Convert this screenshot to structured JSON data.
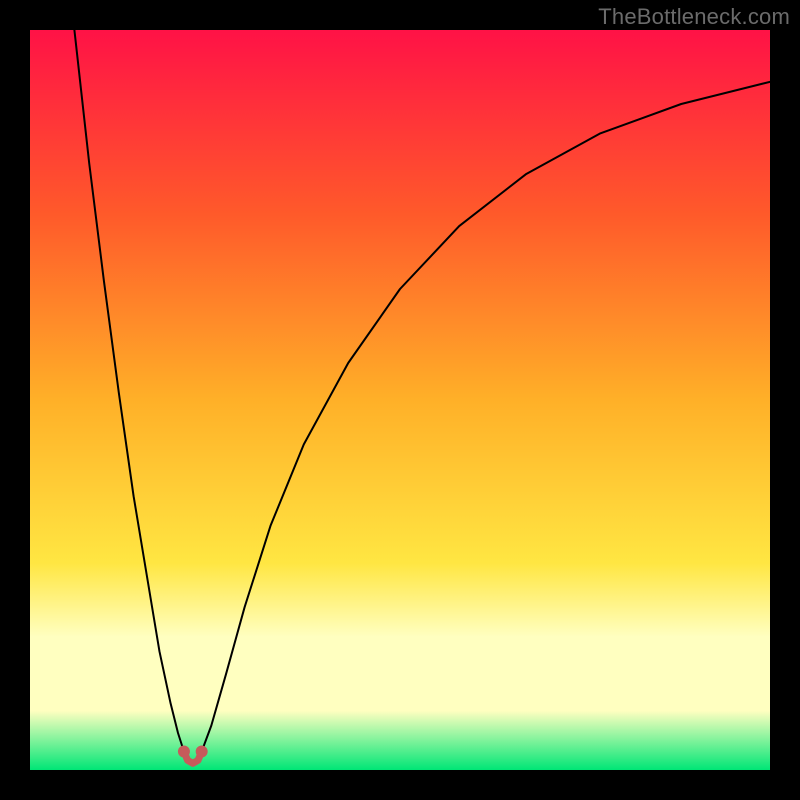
{
  "watermark": "TheBottleneck.com",
  "colors": {
    "frame": "#000000",
    "watermark_text": "#6b6b6b",
    "gradient_top": "#ff1246",
    "gradient_upper_mid": "#ff5a2a",
    "gradient_mid": "#ffb028",
    "gradient_lower_mid": "#ffe642",
    "gradient_pale": "#ffffc0",
    "gradient_bottom": "#00e676",
    "curve": "#000000",
    "marker_fill": "#c65b5b",
    "marker_stroke": "#c65b5b"
  },
  "chart_data": {
    "type": "line",
    "title": "",
    "xlabel": "",
    "ylabel": "",
    "xlim": [
      0,
      100
    ],
    "ylim": [
      0,
      100
    ],
    "legend": false,
    "grid": false,
    "gradient_stops": [
      {
        "offset": 0.0,
        "color_key": "gradient_top"
      },
      {
        "offset": 0.25,
        "color_key": "gradient_upper_mid"
      },
      {
        "offset": 0.5,
        "color_key": "gradient_mid"
      },
      {
        "offset": 0.72,
        "color_key": "gradient_lower_mid"
      },
      {
        "offset": 0.82,
        "color_key": "gradient_pale"
      },
      {
        "offset": 0.92,
        "color_key": "gradient_pale"
      },
      {
        "offset": 1.0,
        "color_key": "gradient_bottom"
      }
    ],
    "series": [
      {
        "name": "left-arm",
        "stroke_key": "curve",
        "stroke_width": 2,
        "points": [
          {
            "x": 6.0,
            "y": 100.0
          },
          {
            "x": 8.0,
            "y": 82.0
          },
          {
            "x": 10.0,
            "y": 66.0
          },
          {
            "x": 12.0,
            "y": 51.0
          },
          {
            "x": 14.0,
            "y": 37.0
          },
          {
            "x": 16.0,
            "y": 25.0
          },
          {
            "x": 17.5,
            "y": 16.0
          },
          {
            "x": 19.0,
            "y": 9.0
          },
          {
            "x": 20.0,
            "y": 5.0
          },
          {
            "x": 20.8,
            "y": 2.5
          }
        ]
      },
      {
        "name": "right-arm",
        "stroke_key": "curve",
        "stroke_width": 2,
        "points": [
          {
            "x": 23.2,
            "y": 2.5
          },
          {
            "x": 24.5,
            "y": 6.0
          },
          {
            "x": 26.5,
            "y": 13.0
          },
          {
            "x": 29.0,
            "y": 22.0
          },
          {
            "x": 32.5,
            "y": 33.0
          },
          {
            "x": 37.0,
            "y": 44.0
          },
          {
            "x": 43.0,
            "y": 55.0
          },
          {
            "x": 50.0,
            "y": 65.0
          },
          {
            "x": 58.0,
            "y": 73.5
          },
          {
            "x": 67.0,
            "y": 80.5
          },
          {
            "x": 77.0,
            "y": 86.0
          },
          {
            "x": 88.0,
            "y": 90.0
          },
          {
            "x": 100.0,
            "y": 93.0
          }
        ]
      },
      {
        "name": "optimum-segment",
        "stroke_key": "marker_stroke",
        "stroke_width": 7,
        "points": [
          {
            "x": 20.8,
            "y": 2.5
          },
          {
            "x": 21.3,
            "y": 1.3
          },
          {
            "x": 22.0,
            "y": 0.9
          },
          {
            "x": 22.7,
            "y": 1.3
          },
          {
            "x": 23.2,
            "y": 2.5
          }
        ]
      }
    ],
    "markers": [
      {
        "x": 20.8,
        "y": 2.5,
        "r": 6,
        "fill_key": "marker_fill"
      },
      {
        "x": 23.2,
        "y": 2.5,
        "r": 6,
        "fill_key": "marker_fill"
      }
    ]
  }
}
